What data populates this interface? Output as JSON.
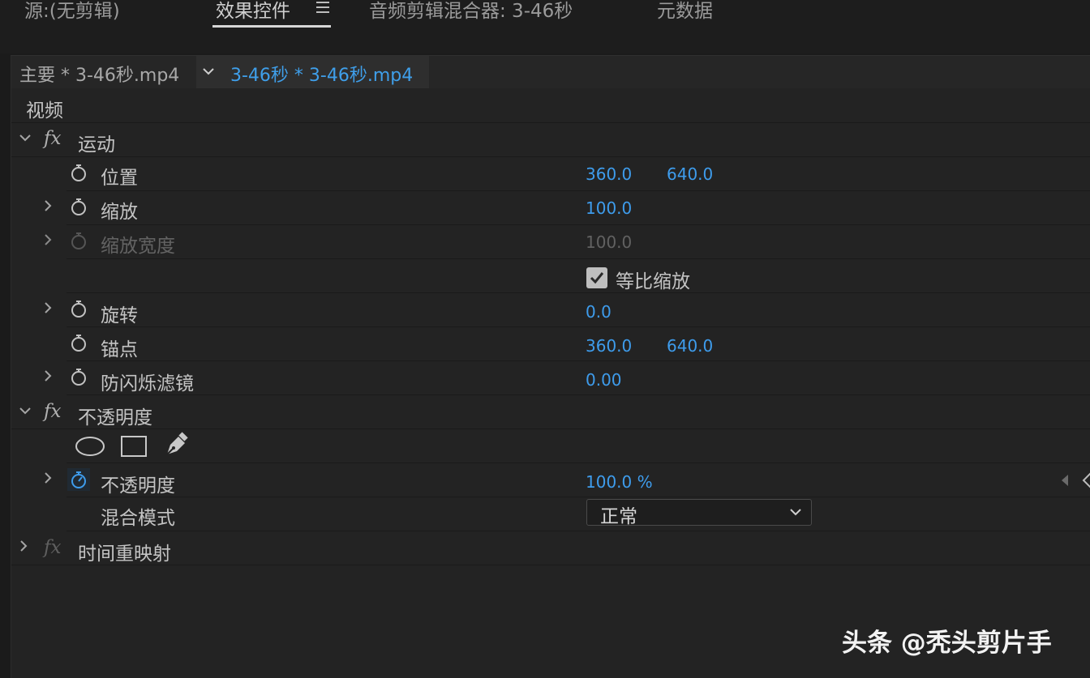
{
  "tabs": {
    "source": "源:(无剪辑)",
    "effect_controls": "效果控件",
    "audio_mixer": "音频剪辑混合器: 3-46秒",
    "metadata": "元数据"
  },
  "clip_bar": {
    "master_clip": "主要 * 3-46秒.mp4",
    "active_clip": "3-46秒 * 3-46秒.mp4"
  },
  "section_video": "视频",
  "effects": {
    "motion": {
      "fx": "fx",
      "label": "运动",
      "position": {
        "label": "位置",
        "x": "360.0",
        "y": "640.0"
      },
      "scale": {
        "label": "缩放",
        "value": "100.0"
      },
      "scale_width": {
        "label": "缩放宽度",
        "value": "100.0"
      },
      "uniform_scale": {
        "label": "等比缩放",
        "checked": true
      },
      "rotation": {
        "label": "旋转",
        "value": "0.0"
      },
      "anchor_point": {
        "label": "锚点",
        "x": "360.0",
        "y": "640.0"
      },
      "anti_flicker": {
        "label": "防闪烁滤镜",
        "value": "0.00"
      }
    },
    "opacity": {
      "fx": "fx",
      "label": "不透明度",
      "mask_tools": [
        "ellipse-mask-icon",
        "rectangle-mask-icon",
        "pen-mask-icon"
      ],
      "opacity": {
        "label": "不透明度",
        "value": "100.0 %"
      },
      "blend_mode": {
        "label": "混合模式",
        "value": "正常"
      }
    },
    "time_remap": {
      "fx": "fx",
      "label": "时间重映射"
    }
  },
  "watermark": "头条 @秃头剪片手",
  "colors": {
    "value_blue": "#3e9cec",
    "panel_bg": "#232323",
    "text": "#c4c4c4"
  }
}
